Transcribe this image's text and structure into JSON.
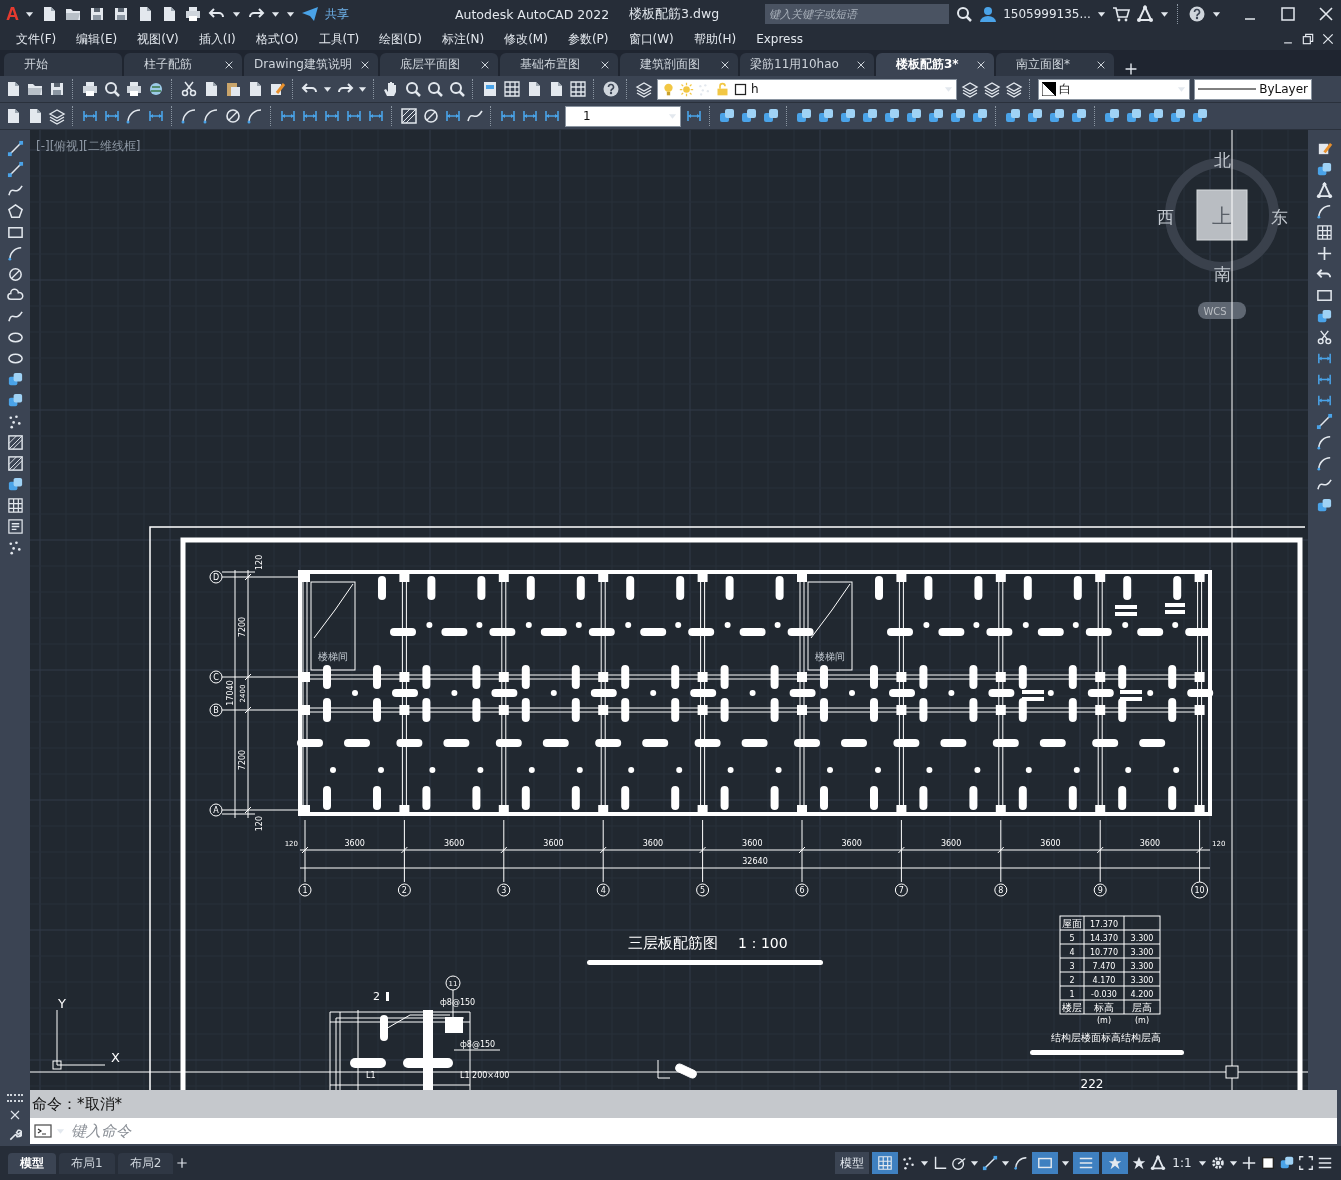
{
  "title_bar": {
    "logo_letter": "A",
    "share_label": "共享",
    "app_title": "Autodesk AutoCAD 2022",
    "file_name": "楼板配筋3.dwg",
    "search": {
      "placeholder": "键入关键字或短语"
    },
    "user": "1505999135..."
  },
  "menu": [
    "文件(F)",
    "编辑(E)",
    "视图(V)",
    "插入(I)",
    "格式(O)",
    "工具(T)",
    "绘图(D)",
    "标注(N)",
    "修改(M)",
    "参数(P)",
    "窗口(W)",
    "帮助(H)",
    "Express"
  ],
  "tabs": [
    {
      "label": "开始",
      "selected": false,
      "closable": false
    },
    {
      "label": "柱子配筋",
      "selected": false,
      "closable": true
    },
    {
      "label": "Drawing建筑说明",
      "selected": false,
      "closable": true
    },
    {
      "label": "底层平面图",
      "selected": false,
      "closable": true
    },
    {
      "label": "基础布置图",
      "selected": false,
      "closable": true
    },
    {
      "label": "建筑剖面图",
      "selected": false,
      "closable": true
    },
    {
      "label": "梁筋11用10hao",
      "selected": false,
      "closable": true
    },
    {
      "label": "楼板配筋3*",
      "selected": true,
      "closable": true
    },
    {
      "label": "南立面图*",
      "selected": false,
      "closable": true
    }
  ],
  "layer_combo": {
    "value": "h"
  },
  "color_combo": {
    "value": "白"
  },
  "linetype_combo": {
    "value": "ByLayer"
  },
  "dimstyle_combo": {
    "value": "1"
  },
  "viewport_label": "[-][俯视][二维线框]",
  "viewcube": {
    "north": "北",
    "south": "南",
    "west": "西",
    "east": "东",
    "top": "上",
    "wcs": "WCS"
  },
  "plan": {
    "x_axes": [
      "1",
      "2",
      "3",
      "4",
      "5",
      "6",
      "7",
      "8",
      "9",
      "10"
    ],
    "y_axes": [
      "D",
      "C",
      "B",
      "A"
    ],
    "spans": [
      "3600",
      "3600",
      "3600",
      "3600",
      "3600",
      "3600",
      "3600",
      "3600",
      "3600"
    ],
    "end_offsets": [
      "120",
      "120"
    ],
    "total": "32640",
    "left_spans": [
      "7200",
      "2400",
      "7200"
    ],
    "left_offsets": [
      "120",
      "120"
    ],
    "left_total": "17040",
    "stair_label": [
      "楼梯间",
      "楼梯间"
    ],
    "title": "三层板配筋图",
    "scale": "1：100"
  },
  "level_table": {
    "rows": [
      [
        "屋面",
        "17.370",
        ""
      ],
      [
        "5",
        "14.370",
        "3.300"
      ],
      [
        "4",
        "10.770",
        "3.300"
      ],
      [
        "3",
        "7.470",
        "3.300"
      ],
      [
        "2",
        "4.170",
        "3.300"
      ],
      [
        "1",
        "-0.030",
        "4.200"
      ],
      [
        "楼层",
        "标高",
        "层高"
      ]
    ],
    "units": [
      "(m)",
      "(m)"
    ],
    "caption": "结构层楼面标高结构层高",
    "below": "222"
  },
  "section": {
    "mark": "2",
    "bubble": "11",
    "rebar_top": "ф8@150",
    "rebar_mid": "ф8@150",
    "beam_left": "L1",
    "beam_right": "L1 200×400"
  },
  "ucs": {
    "y": "Y",
    "x": "X"
  },
  "command": {
    "history": "命令：*取消*",
    "placeholder": "键入命令"
  },
  "layout_tabs": [
    {
      "label": "模型",
      "selected": true
    },
    {
      "label": "布局1",
      "selected": false
    },
    {
      "label": "布局2",
      "selected": false
    }
  ],
  "status": {
    "space": "模型",
    "scale": "1:1"
  }
}
